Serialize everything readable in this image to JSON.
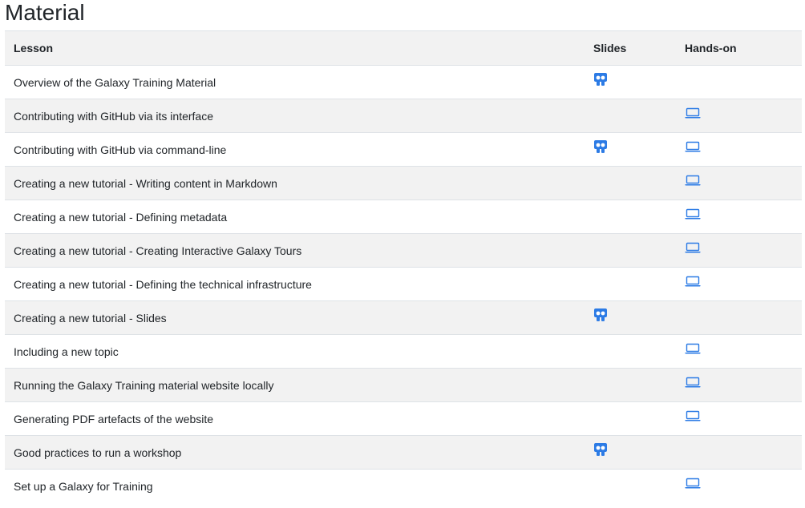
{
  "page": {
    "title": "Material"
  },
  "table": {
    "headers": {
      "lesson": "Lesson",
      "slides": "Slides",
      "hands_on": "Hands-on"
    },
    "rows": [
      {
        "lesson": "Overview of the Galaxy Training Material",
        "slides": true,
        "hands_on": false
      },
      {
        "lesson": "Contributing with GitHub via its interface",
        "slides": false,
        "hands_on": true
      },
      {
        "lesson": "Contributing with GitHub via command-line",
        "slides": true,
        "hands_on": true
      },
      {
        "lesson": "Creating a new tutorial - Writing content in Markdown",
        "slides": false,
        "hands_on": true
      },
      {
        "lesson": "Creating a new tutorial - Defining metadata",
        "slides": false,
        "hands_on": true
      },
      {
        "lesson": "Creating a new tutorial - Creating Interactive Galaxy Tours",
        "slides": false,
        "hands_on": true
      },
      {
        "lesson": "Creating a new tutorial - Defining the technical infrastructure",
        "slides": false,
        "hands_on": true
      },
      {
        "lesson": "Creating a new tutorial - Slides",
        "slides": true,
        "hands_on": false
      },
      {
        "lesson": "Including a new topic",
        "slides": false,
        "hands_on": true
      },
      {
        "lesson": "Running the Galaxy Training material website locally",
        "slides": false,
        "hands_on": true
      },
      {
        "lesson": "Generating PDF artefacts of the website",
        "slides": false,
        "hands_on": true
      },
      {
        "lesson": "Good practices to run a workshop",
        "slides": true,
        "hands_on": false
      },
      {
        "lesson": "Set up a Galaxy for Training",
        "slides": false,
        "hands_on": true
      }
    ]
  },
  "icons": {
    "slides": "slideshare-icon",
    "hands_on": "laptop-icon"
  },
  "colors": {
    "link": "#2c7be5",
    "stripe": "#f2f2f2",
    "border": "#dee2e6",
    "text": "#212529"
  }
}
